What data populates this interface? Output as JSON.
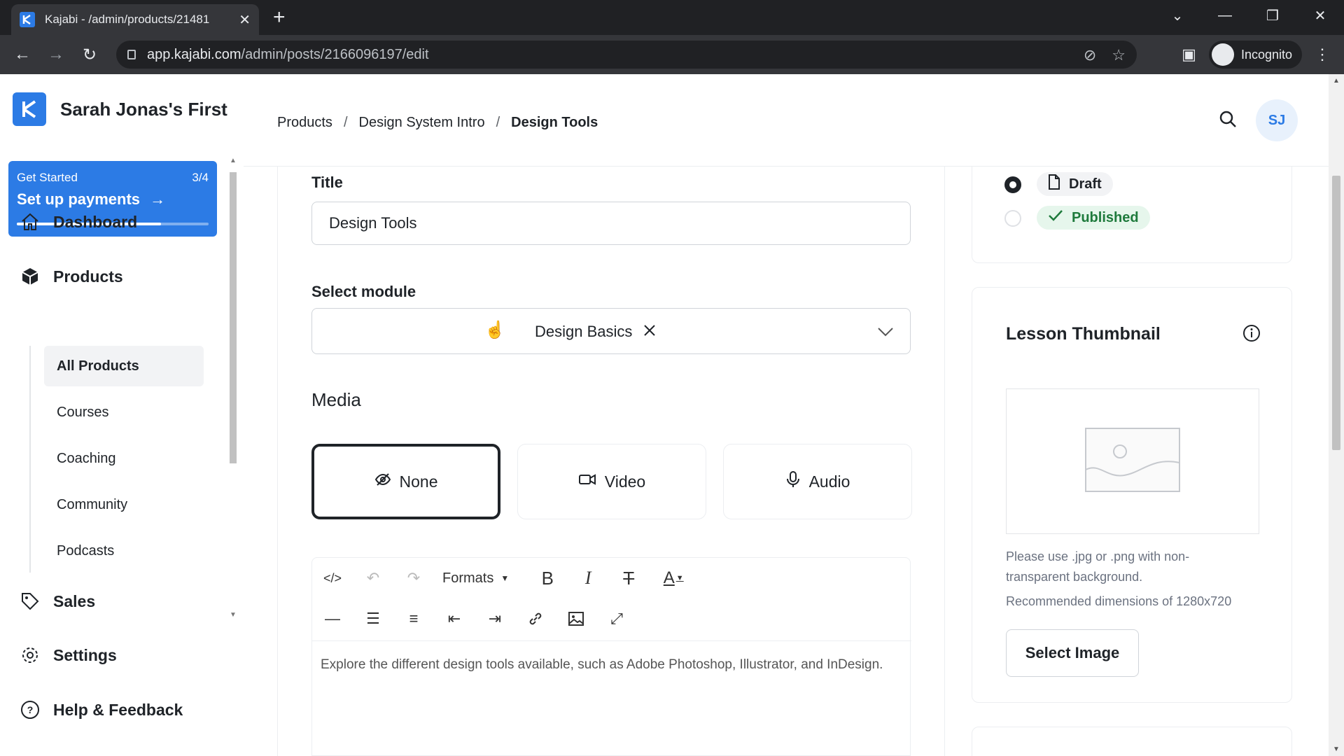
{
  "browser": {
    "tab_title": "Kajabi - /admin/products/21481",
    "url_host": "app.kajabi.com",
    "url_path": "/admin/posts/2166096197/edit",
    "incognito_label": "Incognito"
  },
  "sidebar": {
    "site_name": "Sarah Jonas's First",
    "get_started": {
      "label": "Get Started",
      "progress_text": "3/4",
      "action": "Set up payments",
      "progress_fraction": 0.75
    },
    "nav": {
      "dashboard": "Dashboard",
      "products": "Products",
      "sales": "Sales",
      "settings": "Settings",
      "help": "Help & Feedback"
    },
    "subnav": [
      "All Products",
      "Courses",
      "Coaching",
      "Community",
      "Podcasts"
    ]
  },
  "header": {
    "breadcrumbs": [
      "Products",
      "Design System Intro",
      "Design Tools"
    ],
    "avatar_initials": "SJ"
  },
  "form": {
    "title_label": "Title",
    "title_value": "Design Tools",
    "module_label": "Select module",
    "module_value": "Design Basics",
    "media_label": "Media",
    "media_options": [
      "None",
      "Video",
      "Audio"
    ],
    "media_selected": "None",
    "formats_label": "Formats",
    "body_text": "Explore the different design tools available, such as Adobe Photoshop, Illustrator, and InDesign."
  },
  "status": {
    "draft_label": "Draft",
    "published_label": "Published",
    "selected": "Draft"
  },
  "thumbnail": {
    "title": "Lesson Thumbnail",
    "note": "Please use .jpg or .png with non-transparent background.",
    "dimensions": "Recommended dimensions of 1280x720",
    "button": "Select Image"
  },
  "colors": {
    "accent": "#2c7be5",
    "published_bg": "#e6f6ec",
    "published_text": "#1e7a3c"
  }
}
